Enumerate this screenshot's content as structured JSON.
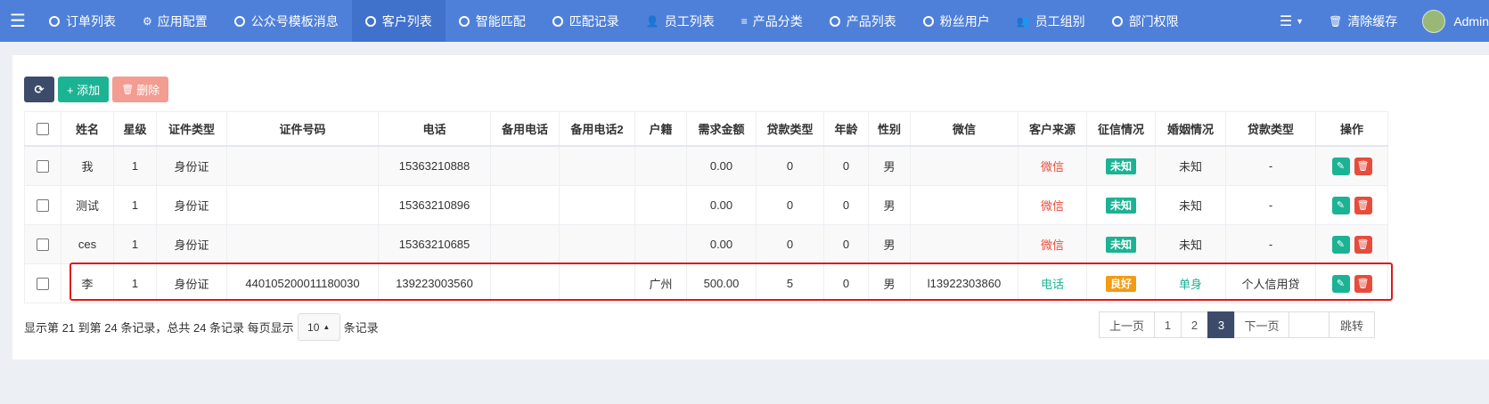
{
  "nav": {
    "menu_icon": "hamburger-icon",
    "items": [
      {
        "label": "订单列表",
        "icon": "circle-icon"
      },
      {
        "label": "应用配置",
        "icon": "gear-icon"
      },
      {
        "label": "公众号模板消息",
        "icon": "circle-icon"
      },
      {
        "label": "客户列表",
        "icon": "circle-icon",
        "active": true
      },
      {
        "label": "智能匹配",
        "icon": "circle-icon"
      },
      {
        "label": "匹配记录",
        "icon": "circle-icon"
      },
      {
        "label": "员工列表",
        "icon": "user-icon"
      },
      {
        "label": "产品分类",
        "icon": "list-icon"
      },
      {
        "label": "产品列表",
        "icon": "circle-icon"
      },
      {
        "label": "粉丝用户",
        "icon": "circle-icon"
      },
      {
        "label": "员工组别",
        "icon": "users-icon"
      },
      {
        "label": "部门权限",
        "icon": "circle-icon"
      }
    ],
    "right": {
      "clear_cache": "清除缓存",
      "user": "Admin"
    }
  },
  "toolbar": {
    "add": "+ 添加",
    "delete": "删除"
  },
  "table": {
    "headers": [
      "姓名",
      "星级",
      "证件类型",
      "证件号码",
      "电话",
      "备用电话",
      "备用电话2",
      "户籍",
      "需求金额",
      "贷款类型",
      "年龄",
      "性别",
      "微信",
      "客户来源",
      "征信情况",
      "婚姻情况",
      "贷款类型",
      "操作"
    ],
    "rows": [
      {
        "name": "我",
        "star": "1",
        "id_type": "身份证",
        "id_no": "",
        "phone": "15363210888",
        "phone2": "",
        "phone3": "",
        "huji": "",
        "amount": "0.00",
        "loan_type": "0",
        "age": "0",
        "sex": "男",
        "wechat": "",
        "source": "微信",
        "credit": "未知",
        "marital": "未知",
        "product": "-"
      },
      {
        "name": "测试",
        "star": "1",
        "id_type": "身份证",
        "id_no": "",
        "phone": "15363210896",
        "phone2": "",
        "phone3": "",
        "huji": "",
        "amount": "0.00",
        "loan_type": "0",
        "age": "0",
        "sex": "男",
        "wechat": "",
        "source": "微信",
        "credit": "未知",
        "marital": "未知",
        "product": "-"
      },
      {
        "name": "ces",
        "star": "1",
        "id_type": "身份证",
        "id_no": "",
        "phone": "15363210685",
        "phone2": "",
        "phone3": "",
        "huji": "",
        "amount": "0.00",
        "loan_type": "0",
        "age": "0",
        "sex": "男",
        "wechat": "",
        "source": "微信",
        "credit": "未知",
        "marital": "未知",
        "product": "-"
      },
      {
        "name": "李",
        "star": "1",
        "id_type": "身份证",
        "id_no": "440105200011180030",
        "phone": "139223003560",
        "phone2": "",
        "phone3": "",
        "huji": "广州",
        "amount": "500.00",
        "loan_type": "5",
        "age": "0",
        "sex": "男",
        "wechat": "l13922303860",
        "source": "电话",
        "credit": "良好",
        "marital": "单身",
        "product": "个人信用贷"
      }
    ]
  },
  "footer": {
    "info_prefix": "显示第 21 到第 24 条记录，总共 24 条记录 每页显示",
    "page_size": "10",
    "info_suffix": "条记录",
    "prev": "上一页",
    "pages": [
      "1",
      "2",
      "3"
    ],
    "current_page": "3",
    "next": "下一页",
    "jump": "跳转"
  },
  "colors": {
    "nav": "#4f80d9",
    "primary": "#1bb394",
    "danger": "#e74c3c",
    "warning": "#f39c12",
    "dark": "#3d4b6b"
  }
}
